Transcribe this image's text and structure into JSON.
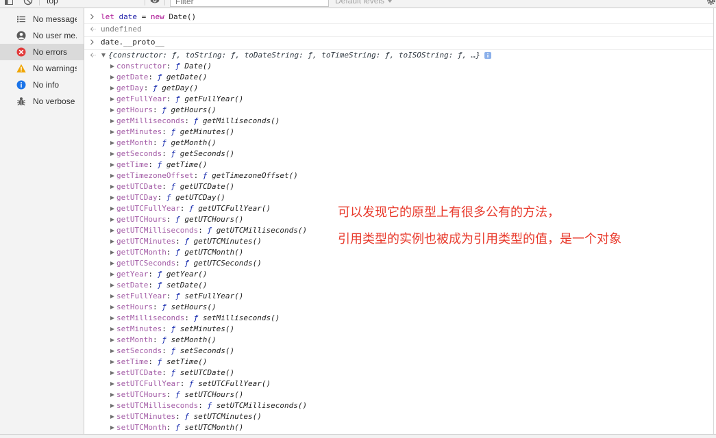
{
  "toolbar": {
    "context": "top",
    "filter_placeholder": "Filter",
    "levels_label": "Default levels"
  },
  "sidebar": {
    "items": [
      {
        "label": "No messages",
        "icon": "list-icon",
        "selected": false
      },
      {
        "label": "No user me...",
        "icon": "user-icon",
        "selected": false
      },
      {
        "label": "No errors",
        "icon": "error-icon",
        "selected": true
      },
      {
        "label": "No warnings",
        "icon": "warning-icon",
        "selected": false
      },
      {
        "label": "No info",
        "icon": "info-icon",
        "selected": false
      },
      {
        "label": "No verbose",
        "icon": "verbose-icon",
        "selected": false
      }
    ]
  },
  "console": {
    "input_1": {
      "tokens": [
        "let",
        " ",
        "date",
        " = ",
        "new",
        " Date()"
      ]
    },
    "result_1": "undefined",
    "input_2": "date.__proto__",
    "proto_result": {
      "preview": "{constructor: ƒ, toString: ƒ, toDateString: ƒ, toTimeString: ƒ, toISOString: ƒ, …}",
      "expanded": true,
      "separator": ":",
      "function_glyph": "ƒ",
      "properties": [
        {
          "key": "constructor",
          "fn": "Date()"
        },
        {
          "key": "getDate",
          "fn": "getDate()"
        },
        {
          "key": "getDay",
          "fn": "getDay()"
        },
        {
          "key": "getFullYear",
          "fn": "getFullYear()"
        },
        {
          "key": "getHours",
          "fn": "getHours()"
        },
        {
          "key": "getMilliseconds",
          "fn": "getMilliseconds()"
        },
        {
          "key": "getMinutes",
          "fn": "getMinutes()"
        },
        {
          "key": "getMonth",
          "fn": "getMonth()"
        },
        {
          "key": "getSeconds",
          "fn": "getSeconds()"
        },
        {
          "key": "getTime",
          "fn": "getTime()"
        },
        {
          "key": "getTimezoneOffset",
          "fn": "getTimezoneOffset()"
        },
        {
          "key": "getUTCDate",
          "fn": "getUTCDate()"
        },
        {
          "key": "getUTCDay",
          "fn": "getUTCDay()"
        },
        {
          "key": "getUTCFullYear",
          "fn": "getUTCFullYear()"
        },
        {
          "key": "getUTCHours",
          "fn": "getUTCHours()"
        },
        {
          "key": "getUTCMilliseconds",
          "fn": "getUTCMilliseconds()"
        },
        {
          "key": "getUTCMinutes",
          "fn": "getUTCMinutes()"
        },
        {
          "key": "getUTCMonth",
          "fn": "getUTCMonth()"
        },
        {
          "key": "getUTCSeconds",
          "fn": "getUTCSeconds()"
        },
        {
          "key": "getYear",
          "fn": "getYear()"
        },
        {
          "key": "setDate",
          "fn": "setDate()"
        },
        {
          "key": "setFullYear",
          "fn": "setFullYear()"
        },
        {
          "key": "setHours",
          "fn": "setHours()"
        },
        {
          "key": "setMilliseconds",
          "fn": "setMilliseconds()"
        },
        {
          "key": "setMinutes",
          "fn": "setMinutes()"
        },
        {
          "key": "setMonth",
          "fn": "setMonth()"
        },
        {
          "key": "setSeconds",
          "fn": "setSeconds()"
        },
        {
          "key": "setTime",
          "fn": "setTime()"
        },
        {
          "key": "setUTCDate",
          "fn": "setUTCDate()"
        },
        {
          "key": "setUTCFullYear",
          "fn": "setUTCFullYear()"
        },
        {
          "key": "setUTCHours",
          "fn": "setUTCHours()"
        },
        {
          "key": "setUTCMilliseconds",
          "fn": "setUTCMilliseconds()"
        },
        {
          "key": "setUTCMinutes",
          "fn": "setUTCMinutes()"
        },
        {
          "key": "setUTCMonth",
          "fn": "setUTCMonth()"
        }
      ]
    }
  },
  "annotation": {
    "lines": [
      "可以发现它的原型上有很多公有的方法，",
      "引用类型的实例也被成为引用类型的值，是一个对象"
    ]
  },
  "colors": {
    "keyword": "#aa0d91",
    "variable": "#1a1aa6",
    "result_gray": "#808080",
    "property_name": "#a35ca6",
    "function_glyph": "#0d22aa",
    "annotation": "#e8392b",
    "error": "#e23b3b",
    "warning": "#f0a500",
    "info": "#1a73e8"
  }
}
